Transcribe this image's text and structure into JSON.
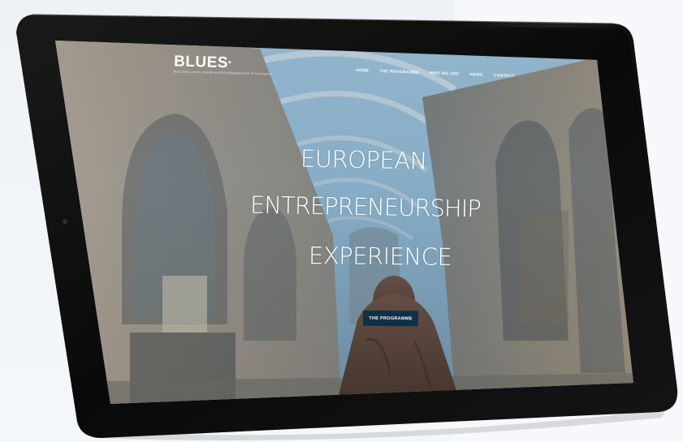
{
  "site": {
    "logo_text": "BLUES",
    "logo_mark": "*",
    "logo_tagline": "BUILDING LINKS UNDER ENTREPRENEURSHIP STRATEGIES"
  },
  "nav": {
    "items": [
      {
        "label": "HOME"
      },
      {
        "label": "THE PROGRAMME"
      },
      {
        "label": "WHO WE ARE"
      },
      {
        "label": "NEWS"
      },
      {
        "label": "CONTACT"
      }
    ]
  },
  "hero": {
    "line1": "EUROPEAN",
    "line2": "ENTREPRENEURSHIP",
    "line3": "EXPERIENCE",
    "cta_label": "THE PROGRAMME"
  },
  "colors": {
    "device_bezel": "#0c0c0c",
    "cta_background": "#0f3147",
    "text": "#ffffff"
  },
  "icons": {
    "device_camera": "camera-dot-icon"
  }
}
